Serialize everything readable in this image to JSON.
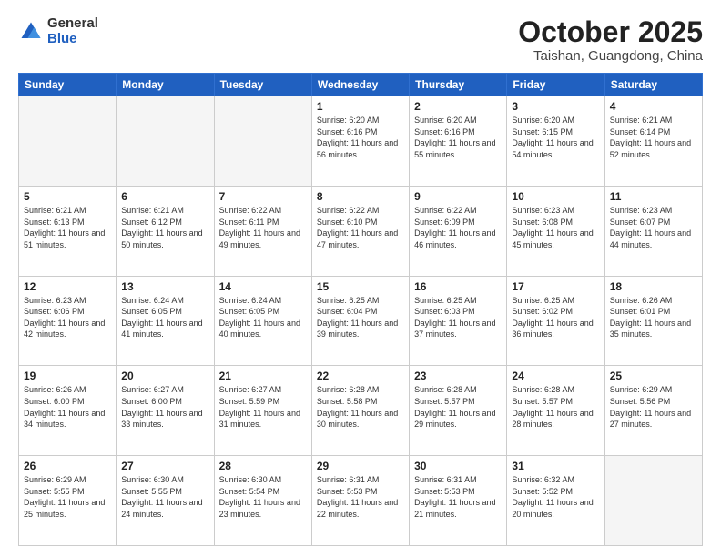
{
  "logo": {
    "general": "General",
    "blue": "Blue"
  },
  "header": {
    "month": "October 2025",
    "location": "Taishan, Guangdong, China"
  },
  "weekdays": [
    "Sunday",
    "Monday",
    "Tuesday",
    "Wednesday",
    "Thursday",
    "Friday",
    "Saturday"
  ],
  "weeks": [
    [
      {
        "day": "",
        "empty": true
      },
      {
        "day": "",
        "empty": true
      },
      {
        "day": "",
        "empty": true
      },
      {
        "day": "1",
        "sunrise": "6:20 AM",
        "sunset": "6:16 PM",
        "daylight": "11 hours and 56 minutes."
      },
      {
        "day": "2",
        "sunrise": "6:20 AM",
        "sunset": "6:16 PM",
        "daylight": "11 hours and 55 minutes."
      },
      {
        "day": "3",
        "sunrise": "6:20 AM",
        "sunset": "6:15 PM",
        "daylight": "11 hours and 54 minutes."
      },
      {
        "day": "4",
        "sunrise": "6:21 AM",
        "sunset": "6:14 PM",
        "daylight": "11 hours and 52 minutes."
      }
    ],
    [
      {
        "day": "5",
        "sunrise": "6:21 AM",
        "sunset": "6:13 PM",
        "daylight": "11 hours and 51 minutes."
      },
      {
        "day": "6",
        "sunrise": "6:21 AM",
        "sunset": "6:12 PM",
        "daylight": "11 hours and 50 minutes."
      },
      {
        "day": "7",
        "sunrise": "6:22 AM",
        "sunset": "6:11 PM",
        "daylight": "11 hours and 49 minutes."
      },
      {
        "day": "8",
        "sunrise": "6:22 AM",
        "sunset": "6:10 PM",
        "daylight": "11 hours and 47 minutes."
      },
      {
        "day": "9",
        "sunrise": "6:22 AM",
        "sunset": "6:09 PM",
        "daylight": "11 hours and 46 minutes."
      },
      {
        "day": "10",
        "sunrise": "6:23 AM",
        "sunset": "6:08 PM",
        "daylight": "11 hours and 45 minutes."
      },
      {
        "day": "11",
        "sunrise": "6:23 AM",
        "sunset": "6:07 PM",
        "daylight": "11 hours and 44 minutes."
      }
    ],
    [
      {
        "day": "12",
        "sunrise": "6:23 AM",
        "sunset": "6:06 PM",
        "daylight": "11 hours and 42 minutes."
      },
      {
        "day": "13",
        "sunrise": "6:24 AM",
        "sunset": "6:05 PM",
        "daylight": "11 hours and 41 minutes."
      },
      {
        "day": "14",
        "sunrise": "6:24 AM",
        "sunset": "6:05 PM",
        "daylight": "11 hours and 40 minutes."
      },
      {
        "day": "15",
        "sunrise": "6:25 AM",
        "sunset": "6:04 PM",
        "daylight": "11 hours and 39 minutes."
      },
      {
        "day": "16",
        "sunrise": "6:25 AM",
        "sunset": "6:03 PM",
        "daylight": "11 hours and 37 minutes."
      },
      {
        "day": "17",
        "sunrise": "6:25 AM",
        "sunset": "6:02 PM",
        "daylight": "11 hours and 36 minutes."
      },
      {
        "day": "18",
        "sunrise": "6:26 AM",
        "sunset": "6:01 PM",
        "daylight": "11 hours and 35 minutes."
      }
    ],
    [
      {
        "day": "19",
        "sunrise": "6:26 AM",
        "sunset": "6:00 PM",
        "daylight": "11 hours and 34 minutes."
      },
      {
        "day": "20",
        "sunrise": "6:27 AM",
        "sunset": "6:00 PM",
        "daylight": "11 hours and 33 minutes."
      },
      {
        "day": "21",
        "sunrise": "6:27 AM",
        "sunset": "5:59 PM",
        "daylight": "11 hours and 31 minutes."
      },
      {
        "day": "22",
        "sunrise": "6:28 AM",
        "sunset": "5:58 PM",
        "daylight": "11 hours and 30 minutes."
      },
      {
        "day": "23",
        "sunrise": "6:28 AM",
        "sunset": "5:57 PM",
        "daylight": "11 hours and 29 minutes."
      },
      {
        "day": "24",
        "sunrise": "6:28 AM",
        "sunset": "5:57 PM",
        "daylight": "11 hours and 28 minutes."
      },
      {
        "day": "25",
        "sunrise": "6:29 AM",
        "sunset": "5:56 PM",
        "daylight": "11 hours and 27 minutes."
      }
    ],
    [
      {
        "day": "26",
        "sunrise": "6:29 AM",
        "sunset": "5:55 PM",
        "daylight": "11 hours and 25 minutes."
      },
      {
        "day": "27",
        "sunrise": "6:30 AM",
        "sunset": "5:55 PM",
        "daylight": "11 hours and 24 minutes."
      },
      {
        "day": "28",
        "sunrise": "6:30 AM",
        "sunset": "5:54 PM",
        "daylight": "11 hours and 23 minutes."
      },
      {
        "day": "29",
        "sunrise": "6:31 AM",
        "sunset": "5:53 PM",
        "daylight": "11 hours and 22 minutes."
      },
      {
        "day": "30",
        "sunrise": "6:31 AM",
        "sunset": "5:53 PM",
        "daylight": "11 hours and 21 minutes."
      },
      {
        "day": "31",
        "sunrise": "6:32 AM",
        "sunset": "5:52 PM",
        "daylight": "11 hours and 20 minutes."
      },
      {
        "day": "",
        "empty": true
      }
    ]
  ]
}
